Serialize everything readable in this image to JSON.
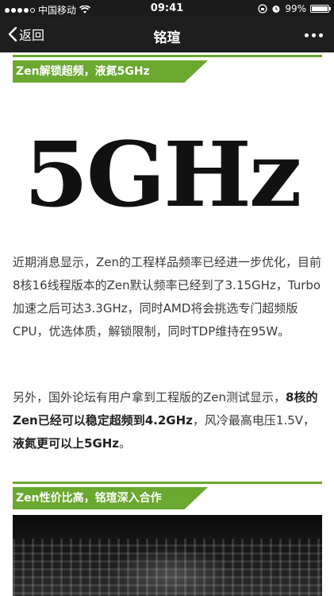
{
  "status_bar": {
    "carrier": "中国移动",
    "time": "09:41",
    "battery": "99%",
    "battery_level": 0.99,
    "signal_bars": 4
  },
  "nav": {
    "back_label": "返回",
    "title": "铭瑄"
  },
  "sections": [
    {
      "title": "Zen解锁超频，液氮5GHz"
    },
    {
      "title": "Zen性价比高，铭瑄深入合作"
    }
  ],
  "logo_text": "5GHz",
  "paragraph1": "近期消息显示，Zen的工程样品频率已经进一步优化，目前8核16线程版本的Zen默认频率已经到了3.15GHz，Turbo加速之后可达3.3GHz，同时AMD将会挑选专门超频版CPU，优选体质，解锁限制，同时TDP维持在95W。",
  "paragraph2": {
    "part1": "另外，国外论坛有用户拿到工程版的Zen测试显示，",
    "bold1": "8核的Zen已经可以稳定超频到4.2GHz",
    "part2": "，风冷最高电压1.5V，",
    "bold2": "液氮更可以上5GHz",
    "part3": "。"
  },
  "colors": {
    "accent_green": "#6aa82f",
    "nav_bg": "#1e1e1e"
  },
  "icons": [
    "wifi-icon",
    "lock-rotation-icon",
    "alarm-icon",
    "back-chevron-icon",
    "more-icon"
  ]
}
